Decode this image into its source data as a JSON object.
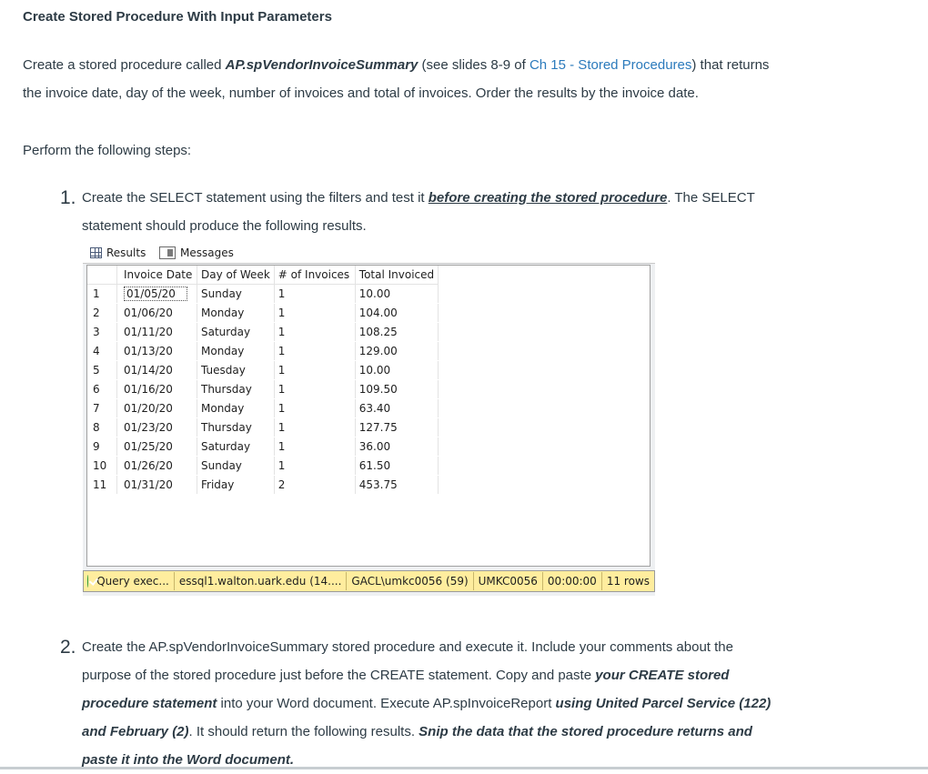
{
  "title": "Create Stored Procedure With Input Parameters",
  "intro": {
    "part1": "Create a stored procedure called ",
    "proc_name": "AP.spVendorInvoiceSummary",
    "part2": " (see slides 8-9 of ",
    "link_text": "Ch 15 - Stored Procedures",
    "part3": ") that returns",
    "line2": "the invoice date,  day of the week, number of invoices and total of invoices.  Order the results by the invoice date."
  },
  "steps_intro": "Perform the following steps:",
  "step1": {
    "number": "1.",
    "line1_a": "Create the SELECT statement using the filters  and test it ",
    "line1_emph": "before creating the stored procedure",
    "line1_b": ".  The SELECT",
    "line2": "statement should produce the following results."
  },
  "ssms": {
    "tabs": {
      "results": "Results",
      "messages": "Messages"
    },
    "columns": [
      "Invoice Date",
      "Day of Week",
      "# of Invoices",
      "Total Invoiced"
    ],
    "rows": [
      [
        "1",
        "01/05/20",
        "Sunday",
        "1",
        "10.00"
      ],
      [
        "2",
        "01/06/20",
        "Monday",
        "1",
        "104.00"
      ],
      [
        "3",
        "01/11/20",
        "Saturday",
        "1",
        "108.25"
      ],
      [
        "4",
        "01/13/20",
        "Monday",
        "1",
        "129.00"
      ],
      [
        "5",
        "01/14/20",
        "Tuesday",
        "1",
        "10.00"
      ],
      [
        "6",
        "01/16/20",
        "Thursday",
        "1",
        "109.50"
      ],
      [
        "7",
        "01/20/20",
        "Monday",
        "1",
        "63.40"
      ],
      [
        "8",
        "01/23/20",
        "Thursday",
        "1",
        "127.75"
      ],
      [
        "9",
        "01/25/20",
        "Saturday",
        "1",
        "36.00"
      ],
      [
        "10",
        "01/26/20",
        "Sunday",
        "1",
        "61.50"
      ],
      [
        "11",
        "01/31/20",
        "Friday",
        "2",
        "453.75"
      ]
    ],
    "status": {
      "query": "Query exec...",
      "server": "essql1.walton.uark.edu (14....",
      "user": "GACL\\umkc0056 (59)",
      "db": "UMKC0056",
      "time": "00:00:00",
      "rows": "11 rows"
    },
    "status_color": "#ffed9e"
  },
  "step2": {
    "number": "2.",
    "line1": "Create the AP.spVendorInvoiceSummary stored procedure and execute it.  Include your comments about the",
    "line2_a": "purpose of the stored procedure just before the CREATE statement.  Copy and paste ",
    "line2_emph": "your CREATE  stored",
    "line3_emph": "procedure statement",
    "line3_b": " into your Word document.  Execute AP.spInvoiceReport ",
    "line3_emph2": "using United Parcel Service (122)",
    "line4_emph": "and February (2)",
    "line4_b": ".  It should return the following results.  ",
    "line4_emph2": "Snip the data that the stored procedure returns and",
    "line5_emph": "paste it into the Word document."
  },
  "colors": {
    "text": "#2d3b45",
    "link": "#2b7abc"
  }
}
